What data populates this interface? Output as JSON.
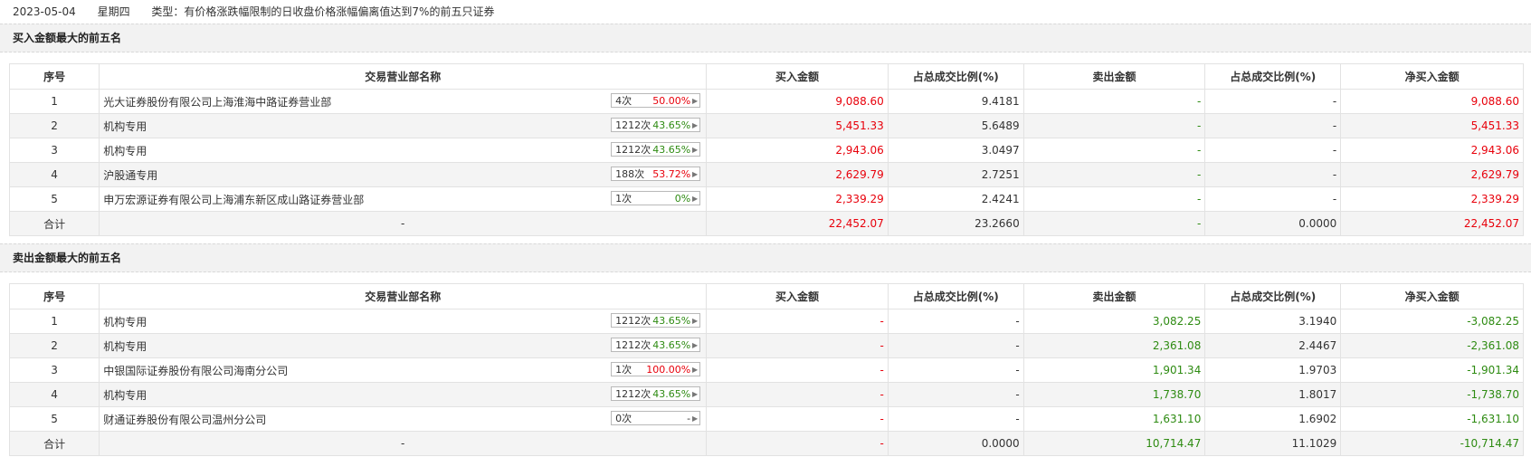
{
  "header": {
    "date": "2023-05-04",
    "weekday": "星期四",
    "type_text": "类型：有价格涨跌幅限制的日收盘价格涨幅偏离值达到7%的前五只证券"
  },
  "columns": [
    "序号",
    "交易营业部名称",
    "买入金额",
    "占总成交比例(%)",
    "卖出金额",
    "占总成交比例(%)",
    "净买入金额"
  ],
  "buy_section": {
    "title": "买入金额最大的前五名",
    "rows": [
      {
        "no": "1",
        "name": "光大证券股份有限公司上海淮海中路证券营业部",
        "count": "4次",
        "pct": "50.00%",
        "pct_color": "red",
        "buy": "9,088.60",
        "buy_ratio": "9.4181",
        "sell": "-",
        "sell_ratio": "-",
        "net": "9,088.60"
      },
      {
        "no": "2",
        "name": "机构专用",
        "count": "1212次",
        "pct": "43.65%",
        "pct_color": "green",
        "buy": "5,451.33",
        "buy_ratio": "5.6489",
        "sell": "-",
        "sell_ratio": "-",
        "net": "5,451.33"
      },
      {
        "no": "3",
        "name": "机构专用",
        "count": "1212次",
        "pct": "43.65%",
        "pct_color": "green",
        "buy": "2,943.06",
        "buy_ratio": "3.0497",
        "sell": "-",
        "sell_ratio": "-",
        "net": "2,943.06"
      },
      {
        "no": "4",
        "name": "沪股通专用",
        "count": "188次",
        "pct": "53.72%",
        "pct_color": "red",
        "buy": "2,629.79",
        "buy_ratio": "2.7251",
        "sell": "-",
        "sell_ratio": "-",
        "net": "2,629.79"
      },
      {
        "no": "5",
        "name": "申万宏源证券有限公司上海浦东新区成山路证券营业部",
        "count": "1次",
        "pct": "0%",
        "pct_color": "green",
        "buy": "2,339.29",
        "buy_ratio": "2.4241",
        "sell": "-",
        "sell_ratio": "-",
        "net": "2,339.29"
      }
    ],
    "total": {
      "label": "合计",
      "name": "-",
      "buy": "22,452.07",
      "buy_ratio": "23.2660",
      "sell": "-",
      "sell_ratio": "0.0000",
      "net": "22,452.07"
    }
  },
  "sell_section": {
    "title": "卖出金额最大的前五名",
    "rows": [
      {
        "no": "1",
        "name": "机构专用",
        "count": "1212次",
        "pct": "43.65%",
        "pct_color": "green",
        "buy": "-",
        "buy_ratio": "-",
        "sell": "3,082.25",
        "sell_ratio": "3.1940",
        "net": "-3,082.25"
      },
      {
        "no": "2",
        "name": "机构专用",
        "count": "1212次",
        "pct": "43.65%",
        "pct_color": "green",
        "buy": "-",
        "buy_ratio": "-",
        "sell": "2,361.08",
        "sell_ratio": "2.4467",
        "net": "-2,361.08"
      },
      {
        "no": "3",
        "name": "中银国际证券股份有限公司海南分公司",
        "count": "1次",
        "pct": "100.00%",
        "pct_color": "red",
        "buy": "-",
        "buy_ratio": "-",
        "sell": "1,901.34",
        "sell_ratio": "1.9703",
        "net": "-1,901.34"
      },
      {
        "no": "4",
        "name": "机构专用",
        "count": "1212次",
        "pct": "43.65%",
        "pct_color": "green",
        "buy": "-",
        "buy_ratio": "-",
        "sell": "1,738.70",
        "sell_ratio": "1.8017",
        "net": "-1,738.70"
      },
      {
        "no": "5",
        "name": "财通证券股份有限公司温州分公司",
        "count": "0次",
        "pct": "-",
        "pct_color": "dark",
        "buy": "-",
        "buy_ratio": "-",
        "sell": "1,631.10",
        "sell_ratio": "1.6902",
        "net": "-1,631.10"
      }
    ],
    "total": {
      "label": "合计",
      "name": "-",
      "buy": "-",
      "buy_ratio": "0.0000",
      "sell": "10,714.47",
      "sell_ratio": "11.1029",
      "net": "-10,714.47"
    }
  },
  "colors": {
    "up": "#e8000b",
    "down": "#2e8b12"
  },
  "icons": {
    "badge_arrow": "triangle-right-icon"
  }
}
